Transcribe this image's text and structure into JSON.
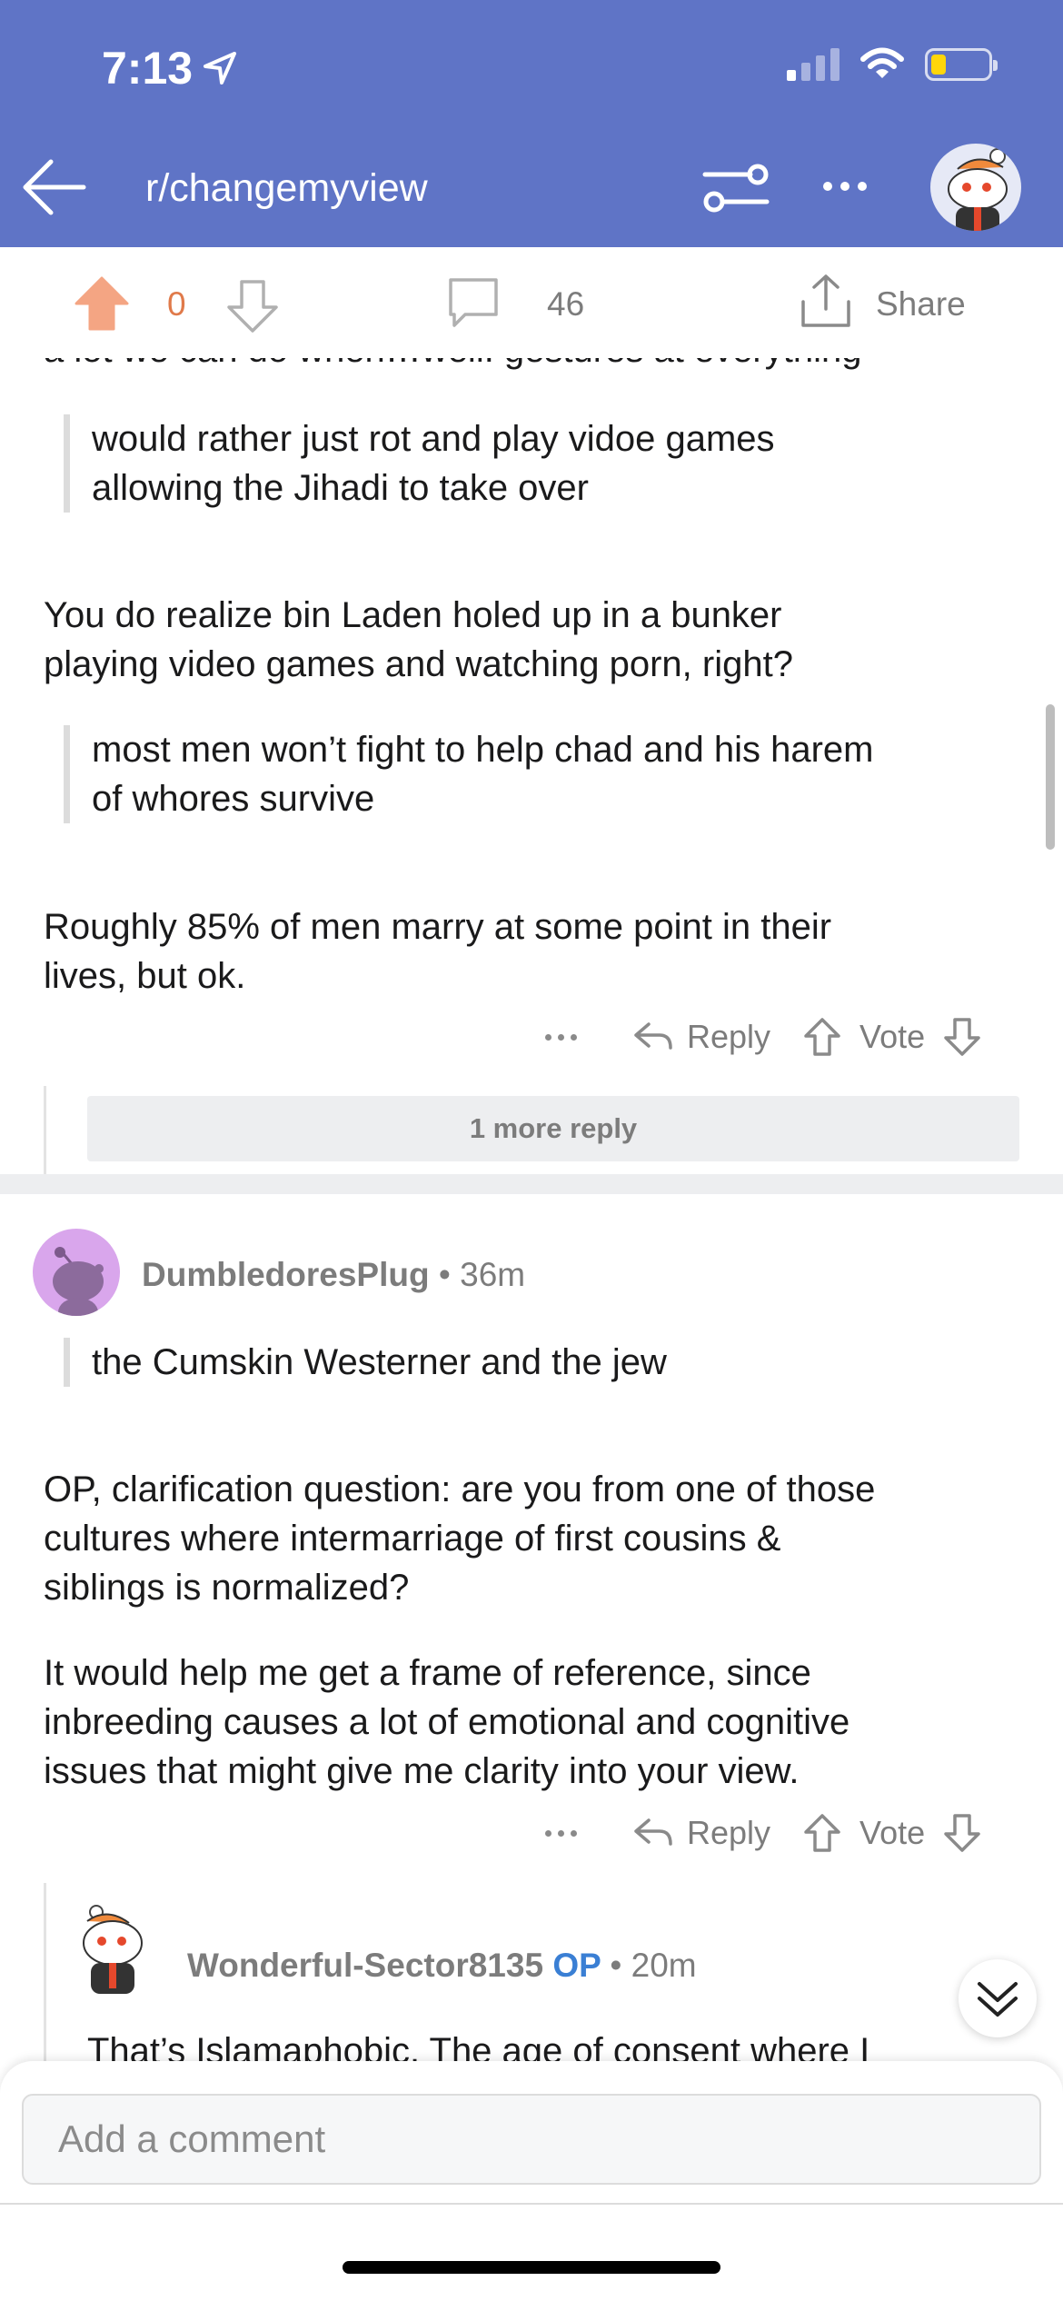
{
  "status_bar": {
    "time": "7:13"
  },
  "header": {
    "subreddit": "r/changemyview"
  },
  "post_actions": {
    "score": "0",
    "comment_count": "46",
    "share_label": "Share"
  },
  "comments": {
    "cut_off_line": "a lot we can do when…well: gestures at everything",
    "quote1": [
      "would rather just rot and play vidoe games",
      "allowing the Jihadi to take over"
    ],
    "para1": [
      "You do realize bin Laden holed up in a bunker",
      "playing video games and watching porn, right?"
    ],
    "quote2": [
      "most men won’t fight to help chad and his harem",
      "of whores survive"
    ],
    "para2": [
      "Roughly 85% of men marry at some point in their",
      "lives, but ok."
    ],
    "reply_label": "Reply",
    "vote_label": "Vote",
    "more_replies": "1 more reply",
    "comment2": {
      "username": "DumbledoresPlug",
      "time": "36m",
      "quote": "the Cumskin Westerner and the jew",
      "para1": [
        "OP, clarification question: are you from one of those",
        "cultures where intermarriage of first cousins &",
        "siblings is normalized?"
      ],
      "para2": [
        "It would help me get a frame of reference, since",
        "inbreeding causes a lot of emotional and cognitive",
        "issues that might give me clarity into your view."
      ]
    },
    "comment3": {
      "username": "Wonderful-Sector8135",
      "op_badge": "OP",
      "time": "20m",
      "text": "That’s Islamaphobic. The age of consent where I"
    }
  },
  "bottom": {
    "comment_placeholder": "Add a comment"
  },
  "colors": {
    "header_bg": "#5f74c6",
    "upvote_accent": "#e07a4a",
    "op_blue": "#3a7fd4"
  }
}
